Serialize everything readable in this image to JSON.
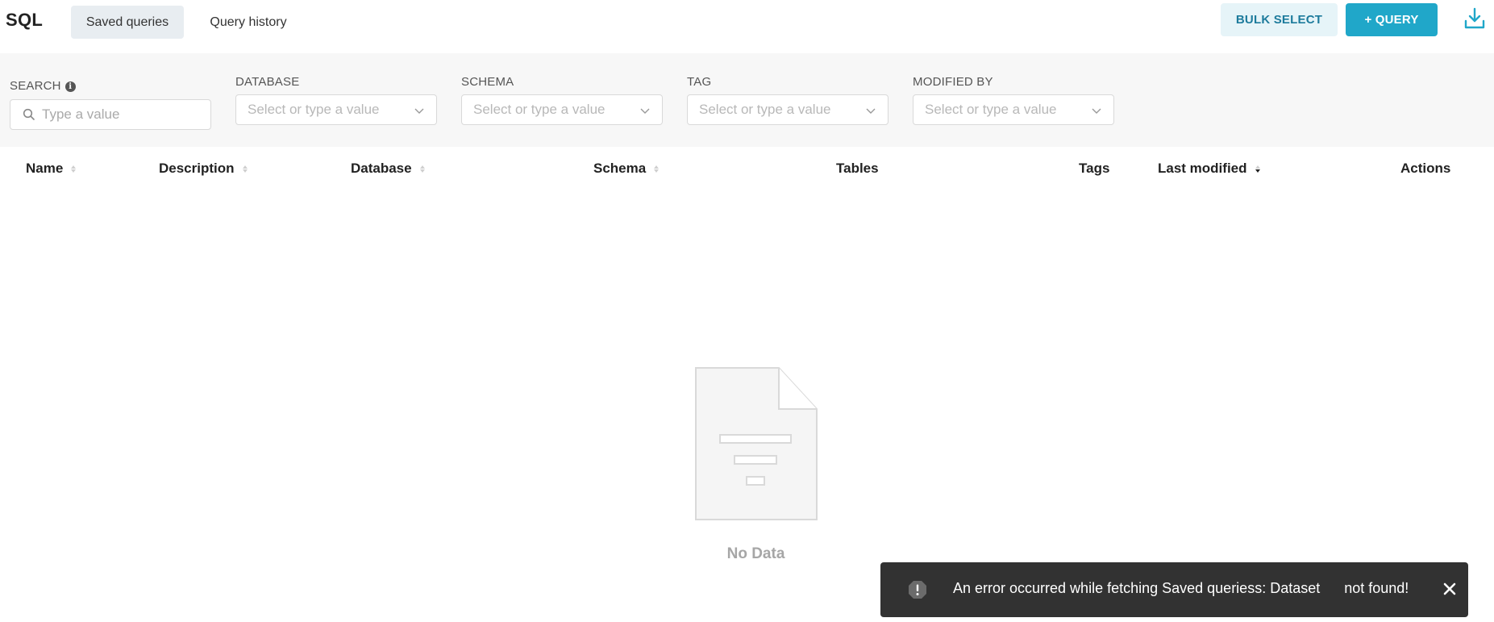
{
  "header": {
    "title": "SQL",
    "tabs": [
      {
        "label": "Saved queries",
        "active": true
      },
      {
        "label": "Query history",
        "active": false
      }
    ],
    "bulk_select_label": "BULK SELECT",
    "add_query_label": "+ QUERY",
    "download_icon": "download-icon"
  },
  "filters": {
    "search": {
      "label": "SEARCH",
      "placeholder": "Type a value"
    },
    "database": {
      "label": "DATABASE",
      "placeholder": "Select or type a value"
    },
    "schema": {
      "label": "SCHEMA",
      "placeholder": "Select or type a value"
    },
    "tag": {
      "label": "TAG",
      "placeholder": "Select or type a value"
    },
    "modified_by": {
      "label": "MODIFIED BY",
      "placeholder": "Select or type a value"
    }
  },
  "table": {
    "columns": [
      {
        "label": "Name",
        "sortable": true
      },
      {
        "label": "Description",
        "sortable": true
      },
      {
        "label": "Database",
        "sortable": true
      },
      {
        "label": "Schema",
        "sortable": true
      },
      {
        "label": "Tables",
        "sortable": false
      },
      {
        "label": "Tags",
        "sortable": false
      },
      {
        "label": "Last modified",
        "sortable": true,
        "sorted": "desc"
      },
      {
        "label": "Actions",
        "sortable": false
      }
    ],
    "rows": [],
    "empty_text": "No Data"
  },
  "toast": {
    "message": "An error occurred while fetching Saved queriess: Dataset      not found!",
    "type": "error"
  },
  "colors": {
    "primary": "#20a7c9",
    "secondary_bg": "#e6f4f8",
    "secondary_text": "#1d7b9c",
    "filter_bg": "#f7f7f7",
    "toast_bg": "#323232"
  }
}
